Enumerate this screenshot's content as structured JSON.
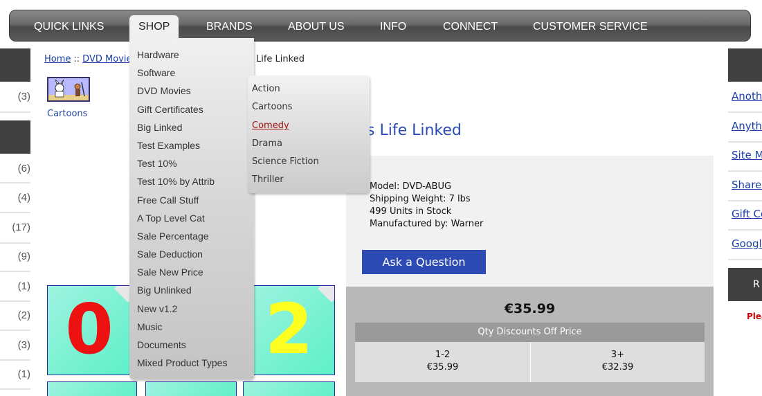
{
  "nav": {
    "items": [
      "QUICK LINKS",
      "SHOP",
      "BRANDS",
      "ABOUT US",
      "INFO",
      "CONNECT",
      "CUSTOMER SERVICE"
    ],
    "active": "SHOP"
  },
  "breadcrumb": {
    "home": "Home",
    "sep": "::",
    "dvd": "DVD Movies",
    "tail": "Life Linked"
  },
  "category": {
    "label": "Cartoons"
  },
  "left": {
    "counts": [
      "(3)",
      "(6)",
      "(4)",
      "(17)",
      "(9)",
      "(1)",
      "(2)",
      "(3)",
      "(1)"
    ]
  },
  "shop_menu": {
    "items": [
      "Hardware",
      "Software",
      "DVD Movies",
      "Gift Certificates",
      "Big Linked",
      "Test Examples",
      "Test 10%",
      "Test 10% by Attrib",
      "Free Call Stuff",
      "A Top Level Cat",
      "Sale Percentage",
      "Sale Deduction",
      "Sale New Price",
      "Big Unlinked",
      "New v1.2",
      "Music",
      "Documents",
      "Mixed Product Types"
    ]
  },
  "dvd_submenu": {
    "items": [
      "Action",
      "Cartoons",
      "Comedy",
      "Drama",
      "Science Fiction",
      "Thriller"
    ],
    "active": "Comedy"
  },
  "product": {
    "title": "s Life Linked",
    "model": "Model: DVD-ABUG",
    "weight": "Shipping Weight: 7 lbs",
    "stock": "499 Units in Stock",
    "manufacturer": "Manufactured by: Warner",
    "ask_button": "Ask a Question",
    "price": "€35.99",
    "qty_header": "Qty Discounts Off Price",
    "qty": [
      {
        "range": "1-2",
        "price": "€35.99"
      },
      {
        "range": "3+",
        "price": "€32.39"
      }
    ]
  },
  "tiles": [
    "0",
    "2"
  ],
  "right": {
    "header_partial": "",
    "links": [
      "Anoth",
      "Anythi",
      "Site M",
      "Shared",
      "Gift Ce",
      "Google"
    ],
    "block2_partial": "R",
    "note": "Plea"
  },
  "colors": {
    "link": "#1a3ea8",
    "title": "#2b4bb5",
    "button": "#2e4bb5",
    "active_submenu": "#a01010",
    "tile_zero": "#ee1111",
    "tile_two": "#ffff22"
  }
}
